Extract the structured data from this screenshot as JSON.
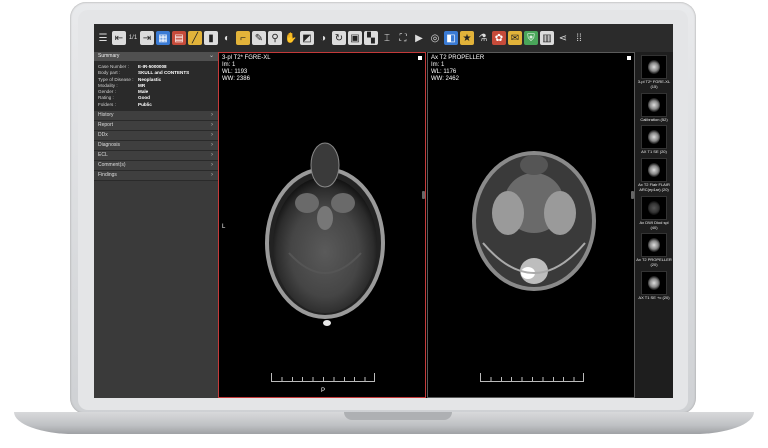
{
  "toolbar": {
    "icons": [
      "menu-icon",
      "layout-1x1-icon",
      "series-1x1-icon",
      "arrow-right-icon",
      "grid-icon",
      "layout-2x2-icon",
      "measure-icon",
      "film-icon",
      "contrast-icon",
      "angle-icon",
      "pencil-icon",
      "magnify-icon",
      "pan-hand-icon",
      "window-level-icon",
      "invert-icon",
      "rotate-icon",
      "image-icon",
      "mosaic-icon",
      "text-cursor-icon",
      "fullscreen-icon",
      "play-icon",
      "cine-icon",
      "stack-icon",
      "star-icon",
      "microscope-icon",
      "paint-icon",
      "chat-icon",
      "shield-icon",
      "calendar-icon",
      "share-icon",
      "apps-grid-icon"
    ],
    "layout_label": "1/1"
  },
  "summary": {
    "title": "Summary",
    "fields": [
      {
        "key": "Case Number :",
        "value": "E-IR-5000008"
      },
      {
        "key": "Body part :",
        "value": "SKULL and CONTENTS"
      },
      {
        "key": "Type of Disease :",
        "value": "Neoplastic"
      },
      {
        "key": "Modality :",
        "value": "MR"
      },
      {
        "key": "Gender :",
        "value": "Male"
      },
      {
        "key": "Rating :",
        "value": "Good"
      },
      {
        "key": "Folders :",
        "value": "Public"
      }
    ]
  },
  "sections": [
    "History",
    "Report",
    "DDx",
    "Diagnosis",
    "ECL",
    "Comment(s)",
    "Findings"
  ],
  "viewport1": {
    "series": "3-pl T2* FGRE-XL",
    "im": "Im: 1",
    "wl": "WL: 1193",
    "ww": "WW: 2386",
    "left_marker": "L",
    "bottom_marker": "P"
  },
  "viewport2": {
    "series": "Ax T2 PROPELLER",
    "im": "Im: 1",
    "wl": "WL: 1176",
    "ww": "WW: 2462"
  },
  "thumbnails": [
    {
      "label": "3-pl T2* FGRE-XL (15)",
      "dark": false
    },
    {
      "label": "Calibration (52)",
      "dark": false
    },
    {
      "label": "AX T1 SE (20)",
      "dark": false
    },
    {
      "label": "Ax T2 Flair FLAIR ARC(ep1ar) (20)",
      "dark": false
    },
    {
      "label": "Ax DWI Diod spl (40)",
      "dark": true
    },
    {
      "label": "Ax T2 PROPELLER (20)",
      "dark": false
    },
    {
      "label": "AX T1 SE +c (20)",
      "dark": false
    }
  ]
}
